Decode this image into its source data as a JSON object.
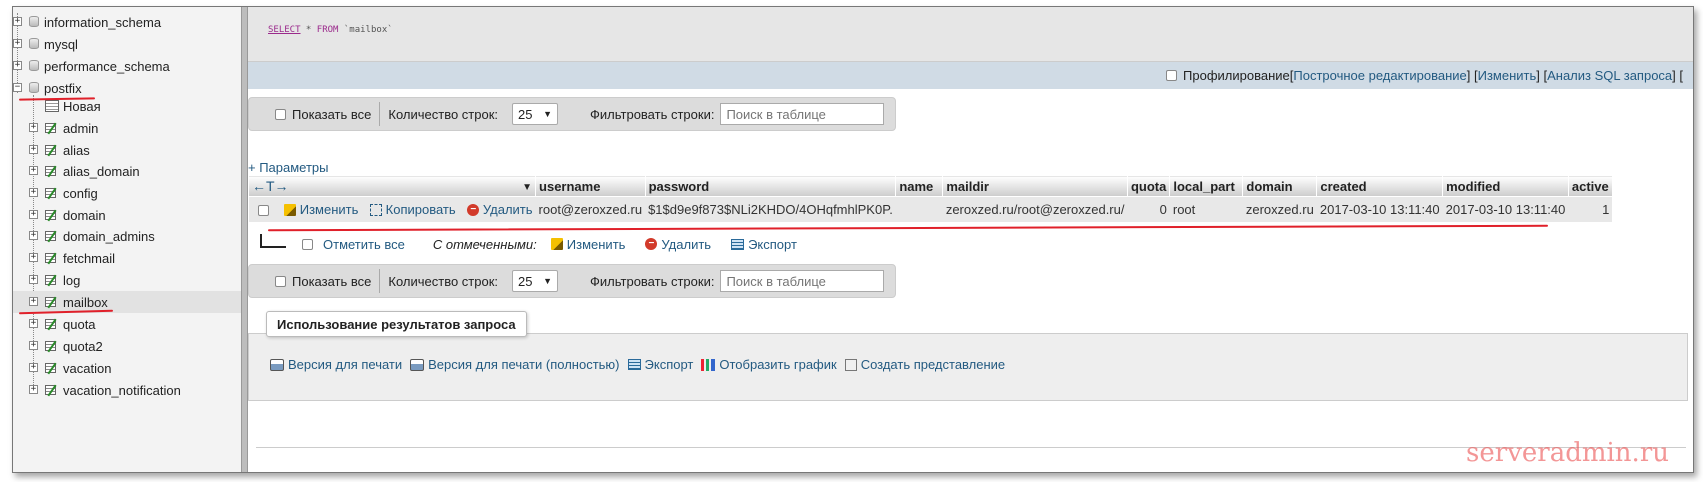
{
  "sidebar": {
    "databases": [
      "information_schema",
      "mysql",
      "performance_schema",
      "postfix"
    ],
    "new_label": "Новая",
    "tables": [
      "admin",
      "alias",
      "alias_domain",
      "config",
      "domain",
      "domain_admins",
      "fetchmail",
      "log",
      "mailbox",
      "quota",
      "quota2",
      "vacation",
      "vacation_notification"
    ],
    "selected_table": "mailbox"
  },
  "sql": {
    "select_kw": "SELECT",
    "star": " * ",
    "from_kw": "FROM",
    "table": " `mailbox`"
  },
  "profile_bar": {
    "profiling": "Профилирование",
    "open_bracket": " [ ",
    "inline_edit": "Построчное редактирование",
    "sep": " ] [ ",
    "edit": "Изменить",
    "sep2": " ] [ ",
    "explain": "Анализ SQL запроса",
    "tail": " ] ["
  },
  "nav": {
    "show_all": "Показать все",
    "row_count_label": "Количество строк:",
    "row_count": "25",
    "filter_label": "Фильтровать строки:",
    "filter_placeholder": "Поиск в таблице"
  },
  "params_link": "+ Параметры",
  "table": {
    "arrows": "←T→",
    "columns": [
      "username",
      "password",
      "name",
      "maildir",
      "quota",
      "local_part",
      "domain",
      "created",
      "modified",
      "active"
    ],
    "row_actions": {
      "edit": "Изменить",
      "copy": "Копировать",
      "delete": "Удалить"
    },
    "rows": [
      {
        "username": "root@zeroxzed.ru",
        "password": "$1$d9e9f873$NLi2KHDO/4OHqfmhlPK0P.",
        "name": "",
        "maildir": "zeroxzed.ru/root@zeroxzed.ru/",
        "quota": "0",
        "local_part": "root",
        "domain": "zeroxzed.ru",
        "created": "2017-03-10 13:11:40",
        "modified": "2017-03-10 13:11:40",
        "active": "1"
      }
    ]
  },
  "with_selected": {
    "check_all": "Отметить все",
    "label": "С отмеченными:",
    "edit": "Изменить",
    "delete": "Удалить",
    "export": "Экспорт"
  },
  "usage": {
    "legend": "Использование результатов запроса",
    "print_view": "Версия для печати",
    "print_view_full": "Версия для печати (полностью)",
    "export": "Экспорт",
    "chart": "Отобразить график",
    "create_view": "Создать представление"
  },
  "watermark": "serveradmin.ru",
  "colors": {
    "link": "#235a81",
    "annotation": "#e0202a"
  }
}
